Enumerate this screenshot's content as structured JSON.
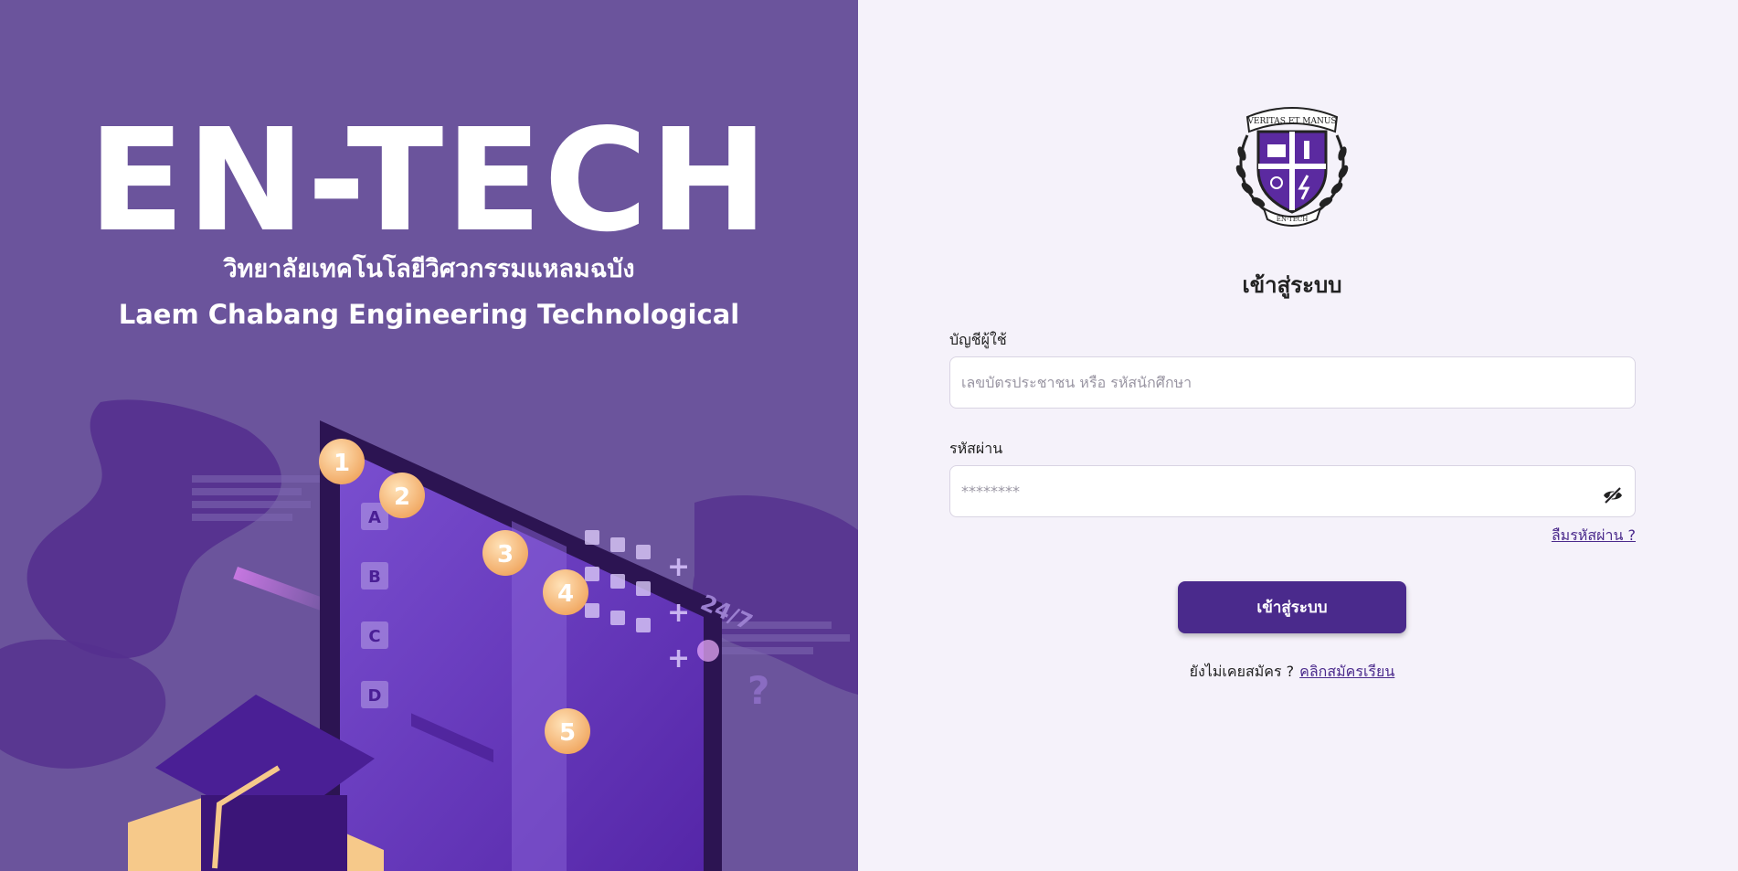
{
  "hero": {
    "title": "EN-TECH",
    "subtitle_th": "วิทยาลัยเทคโนโลยีวิศวกรรมแหลมฉบัง",
    "subtitle_en": "Laem Chabang Engineering Technological",
    "art_labels": {
      "step_1": "1",
      "step_2": "2",
      "step_3": "3",
      "step_4": "4",
      "step_5": "5",
      "doc_a": "A",
      "doc_b": "B",
      "doc_c": "C",
      "doc_d": "D",
      "badge": "24/7",
      "question": "?"
    }
  },
  "logo": {
    "motto": "VERITAS ET MANUS",
    "name": "EN-TECH"
  },
  "form": {
    "title": "เข้าสู่ระบบ",
    "username_label": "บัญชีผู้ใช้",
    "username_placeholder": "เลขบัตรประชาชน หรือ รหัสนักศึกษา",
    "username_value": "",
    "password_label": "รหัสผ่าน",
    "password_placeholder": "********",
    "password_value": "",
    "forgot_link": "ลืมรหัสผ่าน ?",
    "submit_label": "เข้าสู่ระบบ",
    "register_prompt": "ยังไม่เคยสมัคร ?",
    "register_link": "คลิกสมัครเรียน"
  },
  "icons": {
    "password_toggle": "eye-off-icon"
  },
  "colors": {
    "hero_bg": "#6b549c",
    "panel_bg": "#f5f2fa",
    "primary": "#4a2a8c",
    "link": "#4b2a8c"
  }
}
